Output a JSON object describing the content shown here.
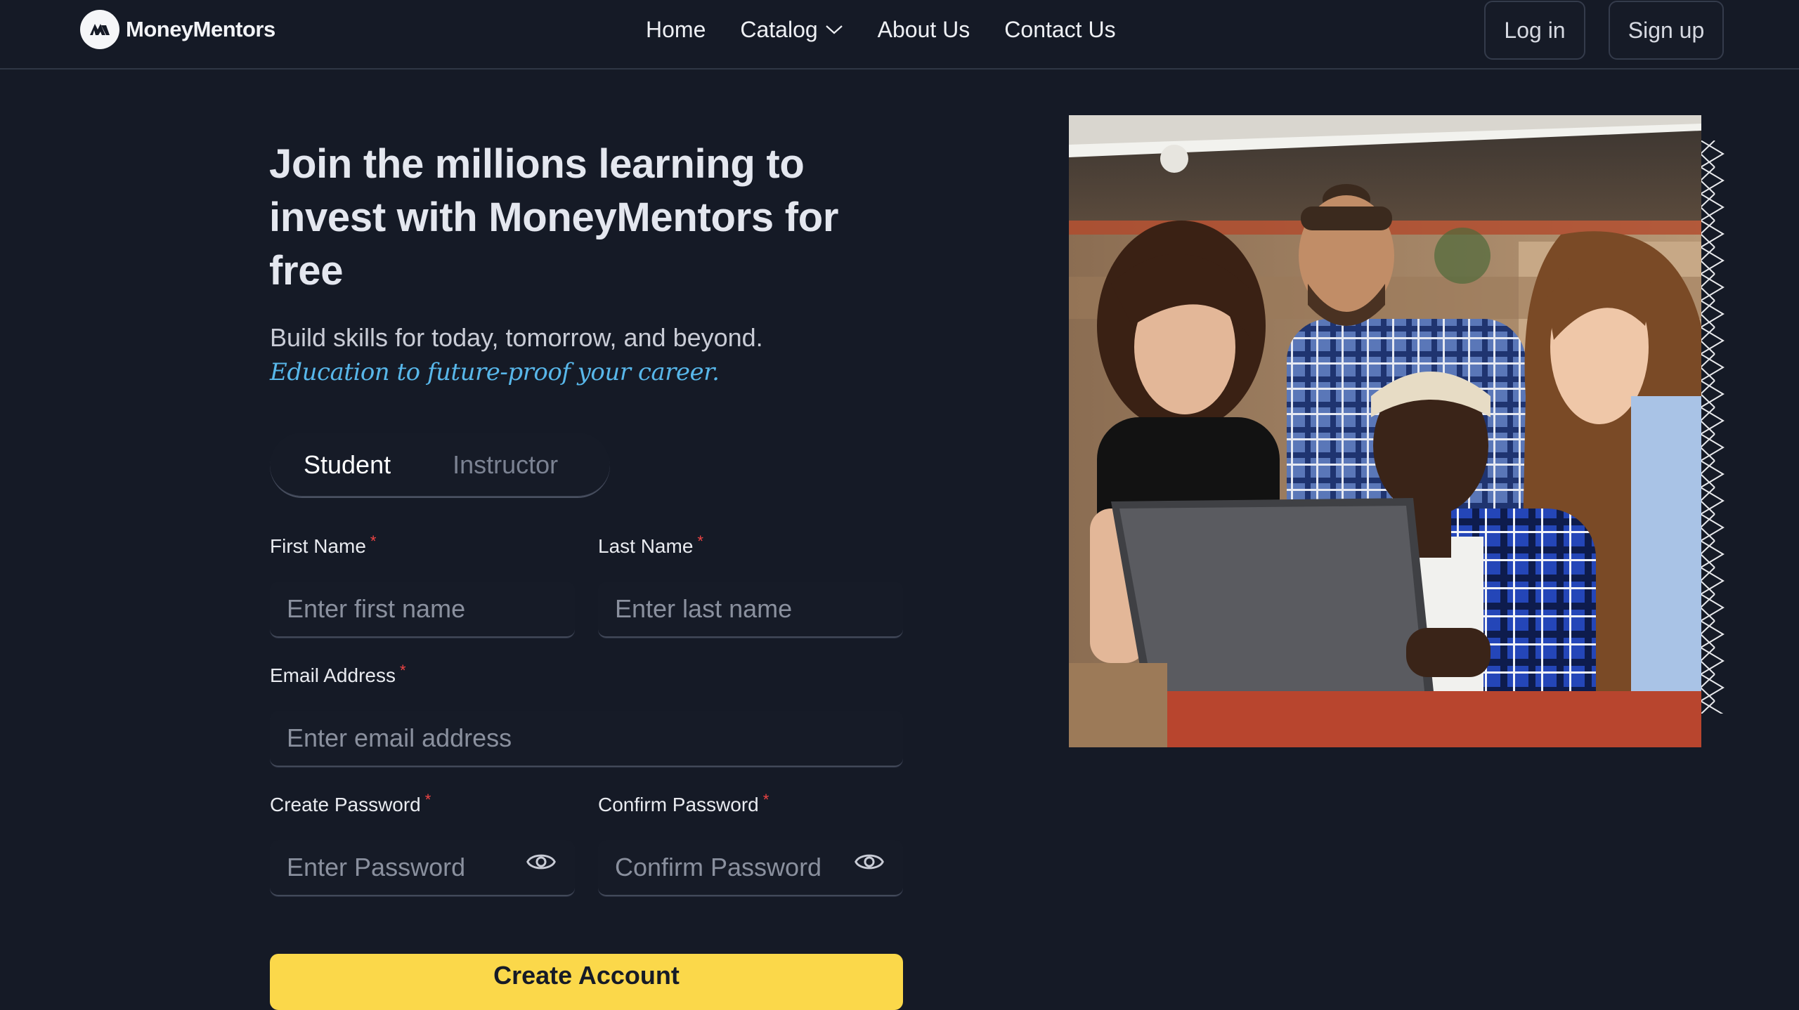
{
  "brand": {
    "name": "MoneyMentors",
    "logo_icon": "money-mentors-logo-icon"
  },
  "nav": {
    "links": [
      "Home",
      "Catalog",
      "About Us",
      "Contact Us"
    ],
    "catalog_icon": "chevron-down-icon",
    "login_label": "Log in",
    "signup_label": "Sign up"
  },
  "hero": {
    "heading": "Join the millions learning to invest with MoneyMentors for free",
    "subtitle": "Build skills for today, tomorrow, and beyond.",
    "tagline": "Education to future-proof your career."
  },
  "role_toggle": {
    "options": [
      "Student",
      "Instructor"
    ],
    "selected": "Student"
  },
  "form": {
    "first_name": {
      "label": "First Name",
      "required_mark": "*",
      "placeholder": "Enter first name",
      "value": ""
    },
    "last_name": {
      "label": "Last Name",
      "required_mark": "*",
      "placeholder": "Enter last name",
      "value": ""
    },
    "email": {
      "label": "Email Address",
      "required_mark": "*",
      "placeholder": "Enter email address",
      "value": ""
    },
    "password": {
      "label": "Create Password",
      "required_mark": "*",
      "placeholder": "Enter Password",
      "value": "",
      "toggle_icon": "eye-icon"
    },
    "confirm_password": {
      "label": "Confirm Password",
      "required_mark": "*",
      "placeholder": "Confirm Password",
      "value": "",
      "toggle_icon": "eye-icon"
    },
    "submit_label": "Create Account"
  },
  "image": {
    "icon": "students-with-laptop-photo",
    "decoration_icon": "zigzag-pattern-icon"
  },
  "colors": {
    "background": "#151a26",
    "accent_yellow": "#fbd84a",
    "tagline_blue": "#58b7ea",
    "required_red": "#ef4444",
    "border": "#2f3645"
  }
}
